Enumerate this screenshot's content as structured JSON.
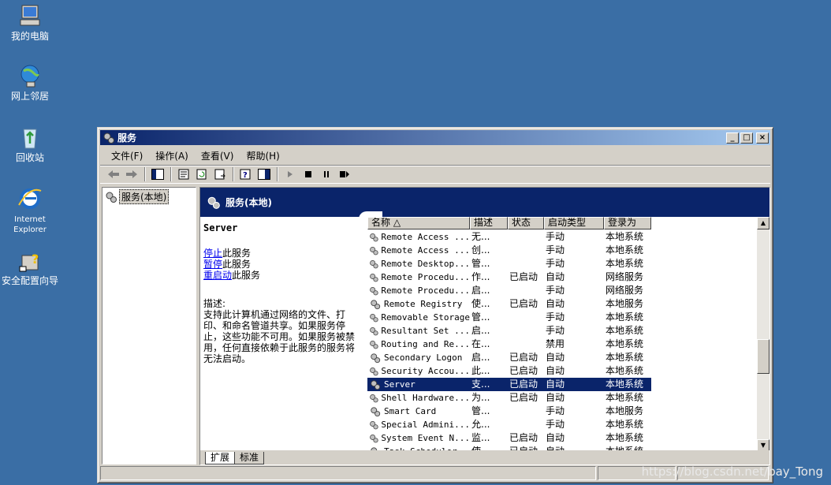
{
  "desktop": {
    "icons": [
      {
        "label": "我的电脑",
        "icon": "my-computer-icon"
      },
      {
        "label": "网上邻居",
        "icon": "network-places-icon"
      },
      {
        "label": "回收站",
        "icon": "recycle-bin-icon"
      },
      {
        "label": "Internet\nExplorer",
        "icon": "internet-explorer-icon"
      },
      {
        "label": "安全配置向导",
        "icon": "security-wizard-icon"
      }
    ]
  },
  "window": {
    "title": "服务",
    "menu": [
      "文件(F)",
      "操作(A)",
      "查看(V)",
      "帮助(H)"
    ],
    "tree_root": "服务(本地)",
    "pane_header": "服务(本地)",
    "selected_service": "Server",
    "actions": [
      {
        "link": "停止",
        "rest": "此服务"
      },
      {
        "link": "暂停",
        "rest": "此服务"
      },
      {
        "link": "重启动",
        "rest": "此服务"
      }
    ],
    "description_label": "描述:",
    "description": "支持此计算机通过网络的文件、打印、和命名管道共享。如果服务停止，这些功能不可用。如果服务被禁用，任何直接依赖于此服务的服务将无法启动。",
    "columns": [
      "名称 △",
      "描述",
      "状态",
      "启动类型",
      "登录为"
    ],
    "services": [
      {
        "name": "Remote Access ...",
        "desc": "无...",
        "status": "",
        "start": "手动",
        "logon": "本地系统"
      },
      {
        "name": "Remote Access ...",
        "desc": "创...",
        "status": "",
        "start": "手动",
        "logon": "本地系统"
      },
      {
        "name": "Remote Desktop...",
        "desc": "管...",
        "status": "",
        "start": "手动",
        "logon": "本地系统"
      },
      {
        "name": "Remote Procedu...",
        "desc": "作...",
        "status": "已启动",
        "start": "自动",
        "logon": "网络服务"
      },
      {
        "name": "Remote Procedu...",
        "desc": "启...",
        "status": "",
        "start": "手动",
        "logon": "网络服务"
      },
      {
        "name": "Remote Registry",
        "desc": "使...",
        "status": "已启动",
        "start": "自动",
        "logon": "本地服务"
      },
      {
        "name": "Removable Storage",
        "desc": "管...",
        "status": "",
        "start": "手动",
        "logon": "本地系统"
      },
      {
        "name": "Resultant Set ...",
        "desc": "启...",
        "status": "",
        "start": "手动",
        "logon": "本地系统"
      },
      {
        "name": "Routing and Re...",
        "desc": "在...",
        "status": "",
        "start": "禁用",
        "logon": "本地系统"
      },
      {
        "name": "Secondary Logon",
        "desc": "启...",
        "status": "已启动",
        "start": "自动",
        "logon": "本地系统"
      },
      {
        "name": "Security Accou...",
        "desc": "此...",
        "status": "已启动",
        "start": "自动",
        "logon": "本地系统"
      },
      {
        "name": "Server",
        "desc": "支...",
        "status": "已启动",
        "start": "自动",
        "logon": "本地系统"
      },
      {
        "name": "Shell Hardware...",
        "desc": "为...",
        "status": "已启动",
        "start": "自动",
        "logon": "本地系统"
      },
      {
        "name": "Smart Card",
        "desc": "管...",
        "status": "",
        "start": "手动",
        "logon": "本地服务"
      },
      {
        "name": "Special Admini...",
        "desc": "允...",
        "status": "",
        "start": "手动",
        "logon": "本地系统"
      },
      {
        "name": "System Event N...",
        "desc": "监...",
        "status": "已启动",
        "start": "自动",
        "logon": "本地系统"
      },
      {
        "name": "Task Scheduler",
        "desc": "使...",
        "status": "已启动",
        "start": "自动",
        "logon": "本地系统"
      }
    ],
    "selected_index": 11,
    "tabs": [
      "扩展",
      "标准"
    ]
  },
  "watermark": "https://blog.csdn.net/bay_Tong",
  "colors": {
    "desktop": "#3a6ea5",
    "title_active": "#0a246a",
    "selection": "#0a246a",
    "face": "#d4d0c8"
  }
}
